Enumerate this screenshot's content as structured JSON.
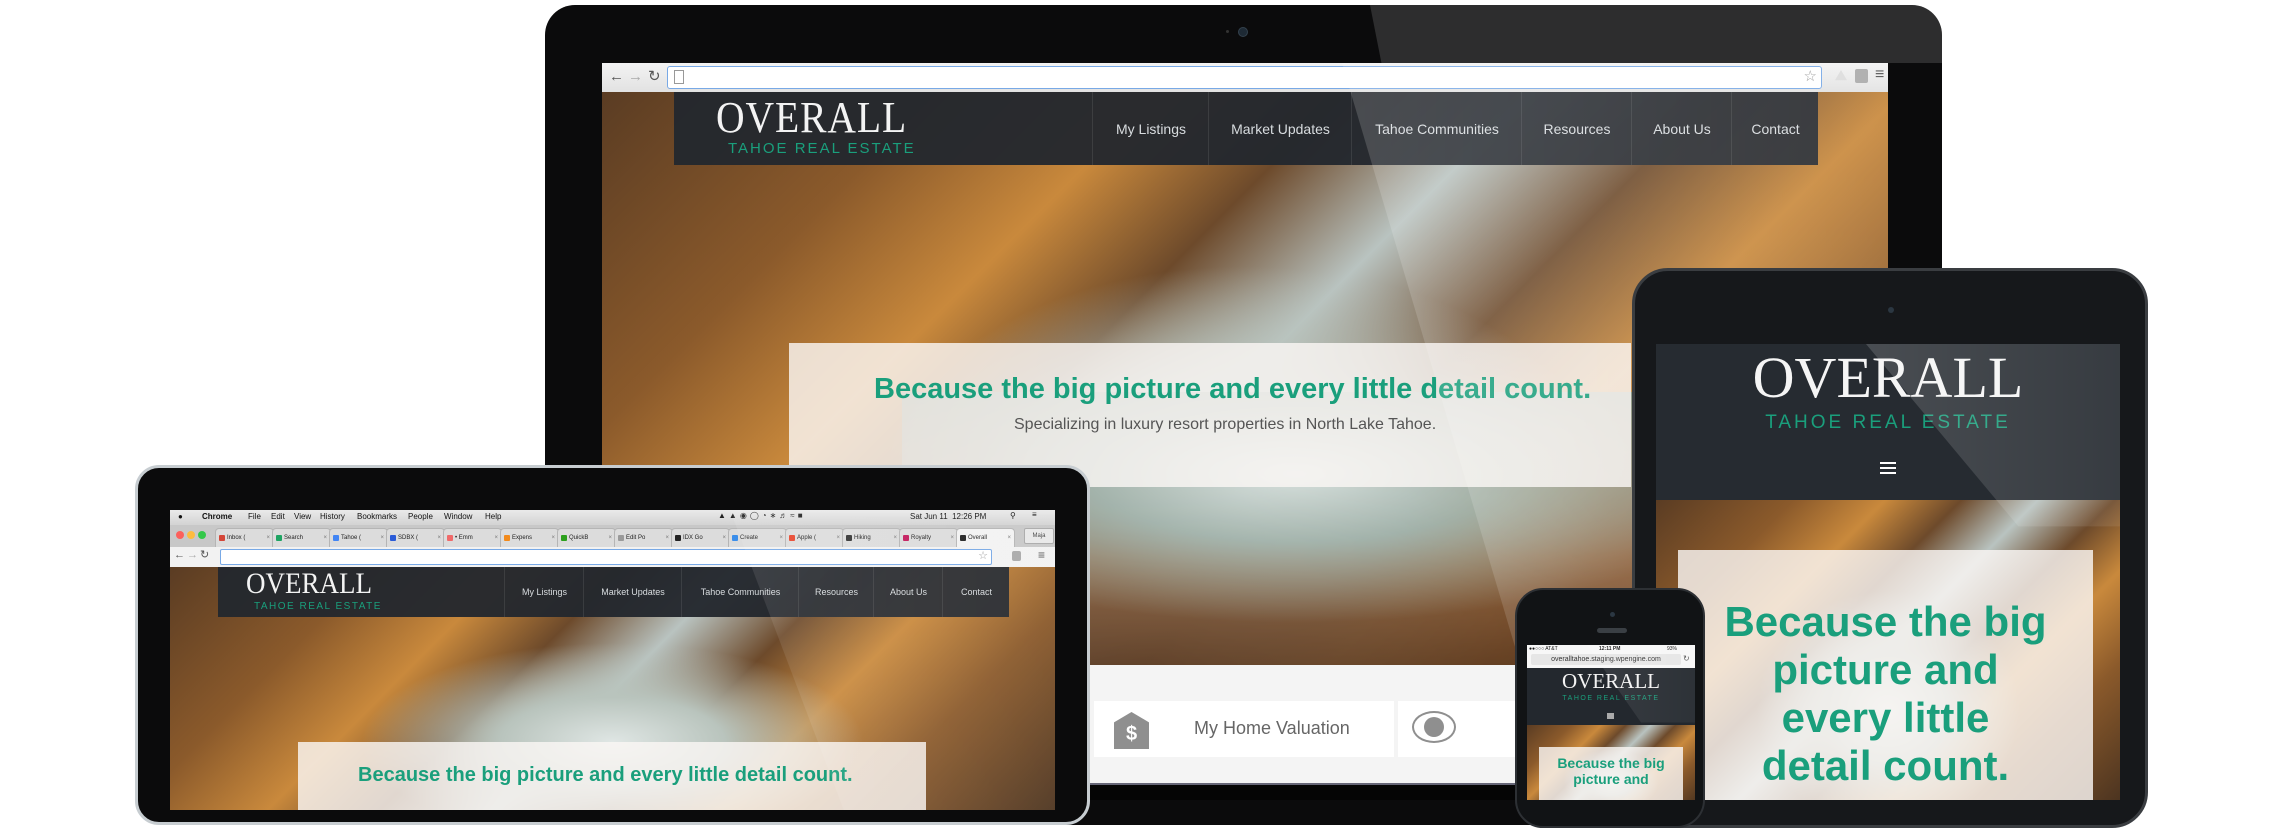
{
  "site": {
    "logo_main": "OVERALL",
    "logo_sub": "TAHOE REAL ESTATE",
    "nav": [
      "My Listings",
      "Market Updates",
      "Tahoe Communities",
      "Resources",
      "About Us",
      "Contact"
    ],
    "headline": "Because the big picture and every little detail count.",
    "headline_lines": [
      "Because the big",
      "picture and",
      "every little",
      "detail count."
    ],
    "tagline": "Specializing in luxury resort properties in North Lake Tahoe.",
    "tiles": [
      {
        "icon": "house-dollar-icon",
        "label": "My Home Valuation"
      },
      {
        "icon": "eye-house-icon",
        "label": ""
      }
    ],
    "menu_icon": "hamburger-menu-icon",
    "accent_color": "#1a9f7c"
  },
  "monitor_browser": {
    "url": "",
    "buttons": [
      "back",
      "forward",
      "reload"
    ],
    "right_icons": [
      "star-icon",
      "extension-drive-icon",
      "extension-icon",
      "menu-icon"
    ]
  },
  "laptop": {
    "menubar": {
      "apple": "",
      "items": [
        "Chrome",
        "File",
        "Edit",
        "View",
        "History",
        "Bookmarks",
        "People",
        "Window",
        "Help"
      ],
      "clock": "Sat Jun 11  12:26 PM"
    },
    "tabs": [
      {
        "label": "Inbox (",
        "color": "#d44638"
      },
      {
        "label": "Search",
        "color": "#1fa463"
      },
      {
        "label": "Tahoe (",
        "color": "#4285f4"
      },
      {
        "label": "SDBX (",
        "color": "#2a5bd7"
      },
      {
        "label": "• Emm",
        "color": "#f06a6a"
      },
      {
        "label": "Expens",
        "color": "#f28a1b"
      },
      {
        "label": "QuickB",
        "color": "#2ca01c"
      },
      {
        "label": "Edit Po",
        "color": "#9a9a9a"
      },
      {
        "label": "IDX Go",
        "color": "#222222"
      },
      {
        "label": "Create",
        "color": "#3b8eea"
      },
      {
        "label": "Apple (",
        "color": "#e8452c"
      },
      {
        "label": "Hiking",
        "color": "#333333"
      },
      {
        "label": "Royalty",
        "color": "#c2185b"
      },
      {
        "label": "Overall",
        "color": "#222222"
      }
    ],
    "profile": "Maja",
    "url": ""
  },
  "phone": {
    "carrier": "●●○○○ AT&T",
    "time": "12:11 PM",
    "battery": "93%",
    "url": "overalltahoe.staging.wpengine.com"
  }
}
